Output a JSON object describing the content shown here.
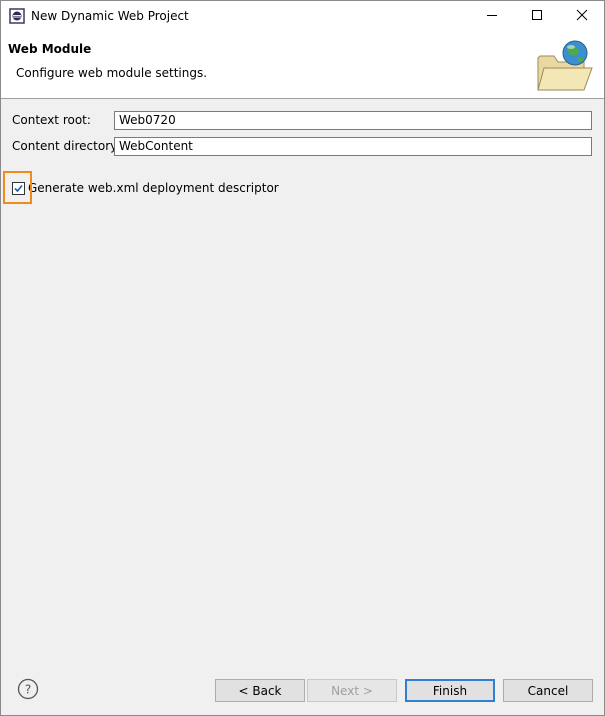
{
  "window": {
    "title": "New Dynamic Web Project",
    "app_icon": "eclipse-icon",
    "controls": {
      "minimize": "minimize-icon",
      "maximize": "maximize-icon",
      "close": "close-icon"
    }
  },
  "banner": {
    "title": "Web Module",
    "description": "Configure web module settings.",
    "icon": "web-folder-globe-icon"
  },
  "form": {
    "context_root": {
      "label": "Context root:",
      "value": "Web0720"
    },
    "content_directory": {
      "label": "Content directory:",
      "value": "WebContent"
    },
    "generate_web_xml": {
      "label": "Generate web.xml deployment descriptor",
      "checked": true
    }
  },
  "buttons": {
    "help_icon": "help-icon",
    "back": "< Back",
    "next": "Next >",
    "finish": "Finish",
    "cancel": "Cancel"
  },
  "colors": {
    "highlight": "#f08a1c",
    "default_button_border": "#2f7fd2"
  }
}
